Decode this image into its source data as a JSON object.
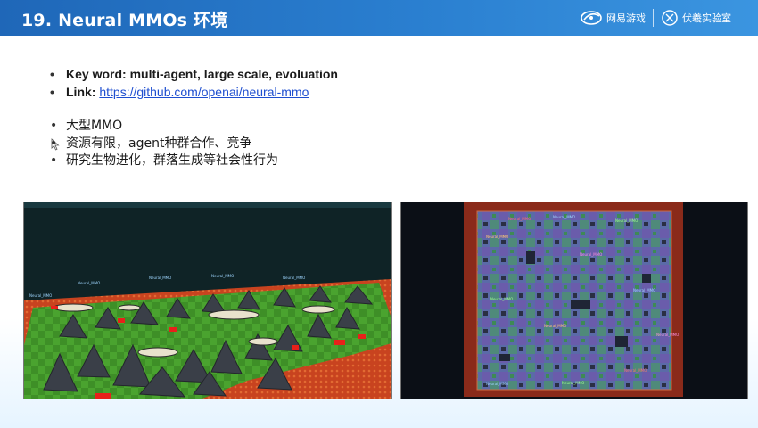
{
  "header": {
    "title": "19. Neural MMOs 环境",
    "logo_netease": "网易游戏",
    "logo_fuxi": "伏羲实验室"
  },
  "bullets_main": [
    {
      "label": "Key word: ",
      "text": "multi-agent, large scale, evoluation"
    },
    {
      "label": "Link: ",
      "link": "https://github.com/openai/neural-mmo"
    }
  ],
  "bullets_cn": [
    "大型MMO",
    "资源有限，agent种群合作、竞争",
    "研究生物进化，群落生成等社会性行为"
  ],
  "colors": {
    "header_blue": "#2a7fd0",
    "link_blue": "#1f4fd0",
    "grass_green": "#3f9a2a",
    "lava_red": "#c23a1c"
  },
  "images": {
    "left": "3d-game-world-render",
    "right": "top-down-map-render"
  }
}
